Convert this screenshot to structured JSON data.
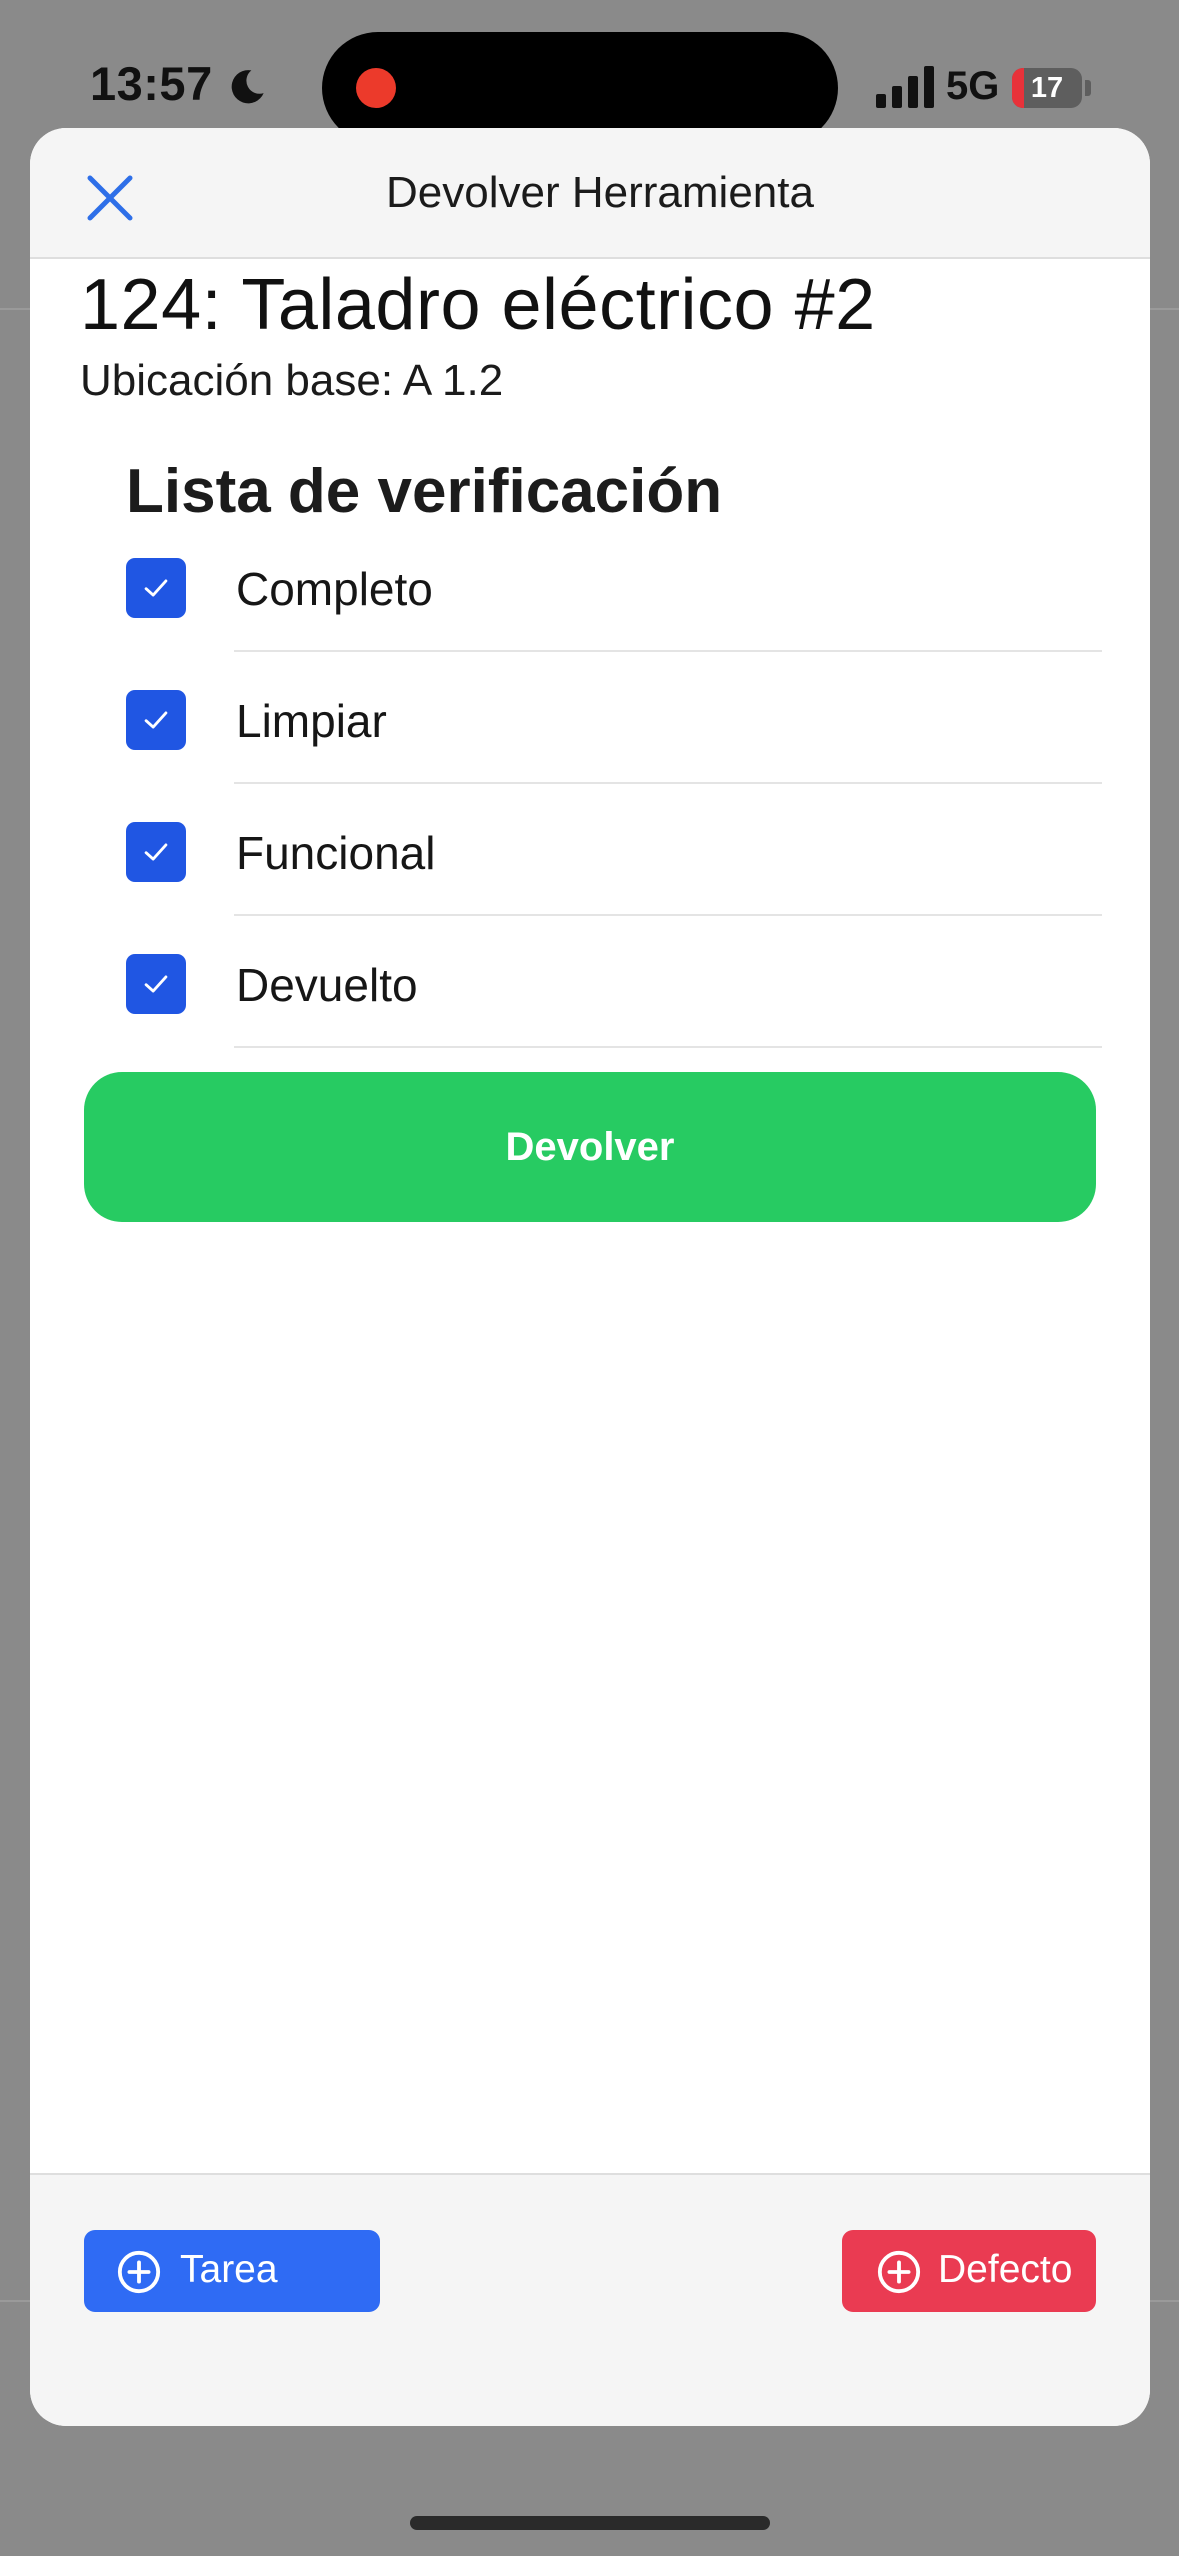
{
  "status_bar": {
    "time": "13:57",
    "network": "5G",
    "battery_level": "17",
    "battery_fraction": 0.17,
    "icons": [
      "moon-icon",
      "signal-icon",
      "battery-icon"
    ]
  },
  "modal": {
    "title": "Devolver Herramienta",
    "close_icon": "close-icon"
  },
  "tool": {
    "title": "124: Taladro eléctrico #2",
    "location": "Ubicación base: A 1.2"
  },
  "checklist": {
    "heading": "Lista de verificación",
    "items": [
      {
        "label": "Completo",
        "checked": true
      },
      {
        "label": "Limpiar",
        "checked": true
      },
      {
        "label": "Funcional",
        "checked": true
      },
      {
        "label": "Devuelto",
        "checked": true
      }
    ]
  },
  "actions": {
    "return_label": "Devolver"
  },
  "footer": {
    "task_label": "Tarea",
    "defect_label": "Defecto"
  },
  "colors": {
    "accent_blue": "#2056e3",
    "success_green": "#27cb62",
    "task_blue": "#2f6bf4",
    "danger_red": "#ea3b52"
  }
}
